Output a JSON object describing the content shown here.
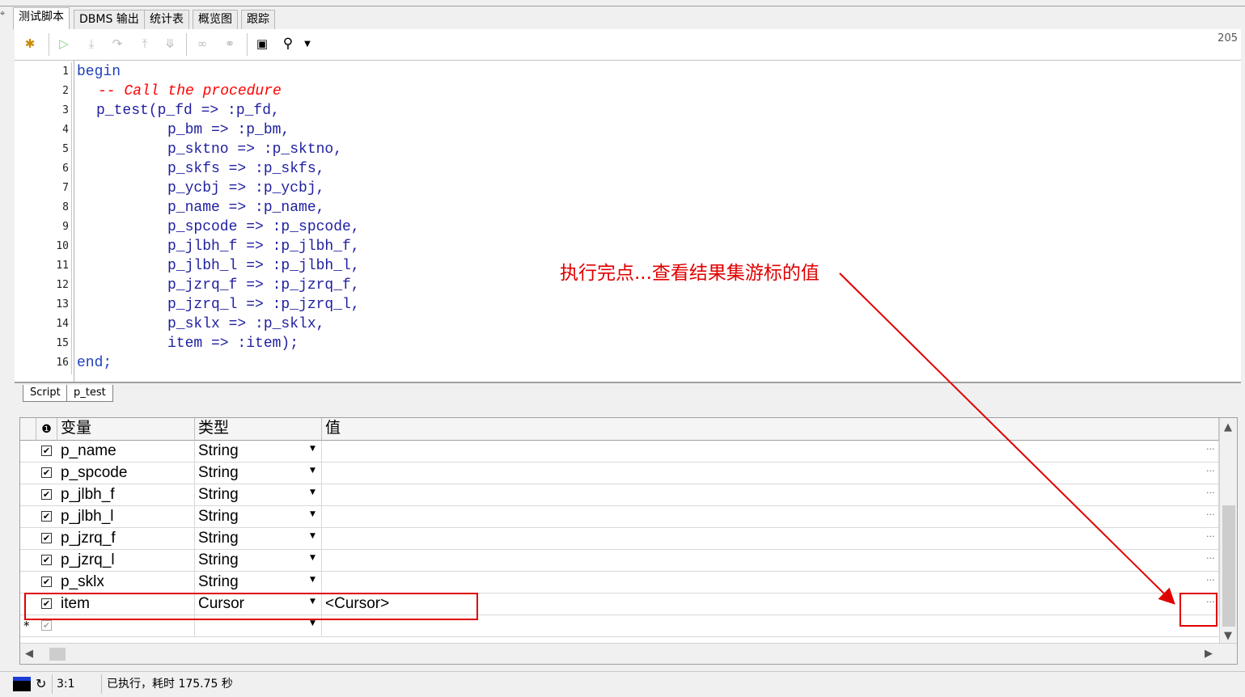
{
  "tabs": [
    {
      "label": "测试脚本",
      "active": true
    },
    {
      "label": "DBMS 输出",
      "active": false
    },
    {
      "label": "统计表",
      "active": false
    },
    {
      "label": "概览图",
      "active": false
    },
    {
      "label": "跟踪",
      "active": false
    }
  ],
  "toolbar": {
    "corner_number": "205",
    "icons": [
      "debug-icon",
      "run-icon",
      "step-into-icon",
      "step-over-icon",
      "step-out-icon",
      "run-to-exception-icon",
      "break-icon",
      "watch-icon",
      "output-icon",
      "search-icon",
      "dropdown-arrow-icon"
    ]
  },
  "editor": {
    "lines": [
      {
        "n": "1",
        "text": "begin"
      },
      {
        "n": "2",
        "text": "-- Call the procedure"
      },
      {
        "n": "3",
        "text": "p_test(p_fd => :p_fd,"
      },
      {
        "n": "4",
        "text": "p_bm => :p_bm,"
      },
      {
        "n": "5",
        "text": "p_sktno => :p_sktno,"
      },
      {
        "n": "6",
        "text": "p_skfs => :p_skfs,"
      },
      {
        "n": "7",
        "text": "p_ycbj => :p_ycbj,"
      },
      {
        "n": "8",
        "text": "p_name => :p_name,"
      },
      {
        "n": "9",
        "text": "p_spcode => :p_spcode,"
      },
      {
        "n": "10",
        "text": "p_jlbh_f => :p_jlbh_f,"
      },
      {
        "n": "11",
        "text": "p_jlbh_l => :p_jlbh_l,"
      },
      {
        "n": "12",
        "text": "p_jzrq_f => :p_jzrq_f,"
      },
      {
        "n": "13",
        "text": "p_jzrq_l => :p_jzrq_l,"
      },
      {
        "n": "14",
        "text": "p_sklx => :p_sklx,"
      },
      {
        "n": "15",
        "text": "item => :item);"
      },
      {
        "n": "16",
        "text": "end;"
      }
    ]
  },
  "sheet_tabs": [
    "Script",
    "p_test"
  ],
  "grid": {
    "headers": {
      "variable": "变量",
      "type": "类型",
      "value": "值"
    },
    "rows": [
      {
        "var": "p_name",
        "type": "String",
        "value": ""
      },
      {
        "var": "p_spcode",
        "type": "String",
        "value": ""
      },
      {
        "var": "p_jlbh_f",
        "type": "String",
        "value": ""
      },
      {
        "var": "p_jlbh_l",
        "type": "String",
        "value": ""
      },
      {
        "var": "p_jzrq_f",
        "type": "String",
        "value": ""
      },
      {
        "var": "p_jzrq_l",
        "type": "String",
        "value": ""
      },
      {
        "var": "p_sklx",
        "type": "String",
        "value": ""
      },
      {
        "var": "item",
        "type": "Cursor",
        "value": "<Cursor>"
      }
    ],
    "new_row_marker": "*",
    "ellipsis": "...",
    "checkmark": "✔"
  },
  "annotation": {
    "text": "执行完点...查看结果集游标的值",
    "color": "#e00000"
  },
  "status": {
    "position": "3:1",
    "message": "已执行，耗时 175.75 秒"
  }
}
